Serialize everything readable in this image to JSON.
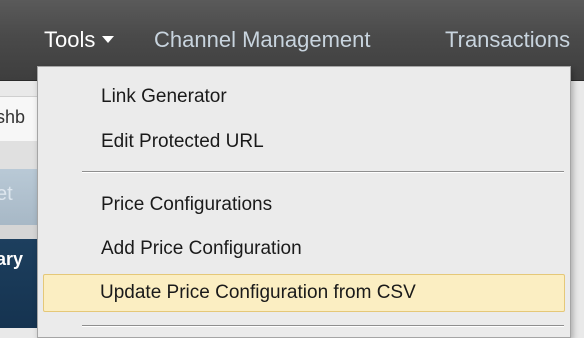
{
  "nav": {
    "tools": "Tools",
    "channel_management": "Channel Management",
    "transactions": "Transactions"
  },
  "background": {
    "breadcrumb_fragment": "shb",
    "tab_fragment": "et",
    "header_fragment": "ary"
  },
  "tools_menu": {
    "items": [
      {
        "label": "Link Generator"
      },
      {
        "label": "Edit Protected URL"
      },
      {
        "label": "Price Configurations"
      },
      {
        "label": "Add Price Configuration"
      },
      {
        "label": "Update Price Configuration from CSV",
        "highlighted": true
      }
    ]
  },
  "colors": {
    "navbar": "#4a4a4a",
    "nav_active_text": "#ffffff",
    "nav_text": "#c8d4de",
    "menu_background": "#ebebeb",
    "menu_highlight": "#fbeec2",
    "menu_highlight_border": "#e5c878",
    "page_header": "#1d3f5e"
  },
  "icons": {
    "tools_caret": "caret-down-icon"
  }
}
